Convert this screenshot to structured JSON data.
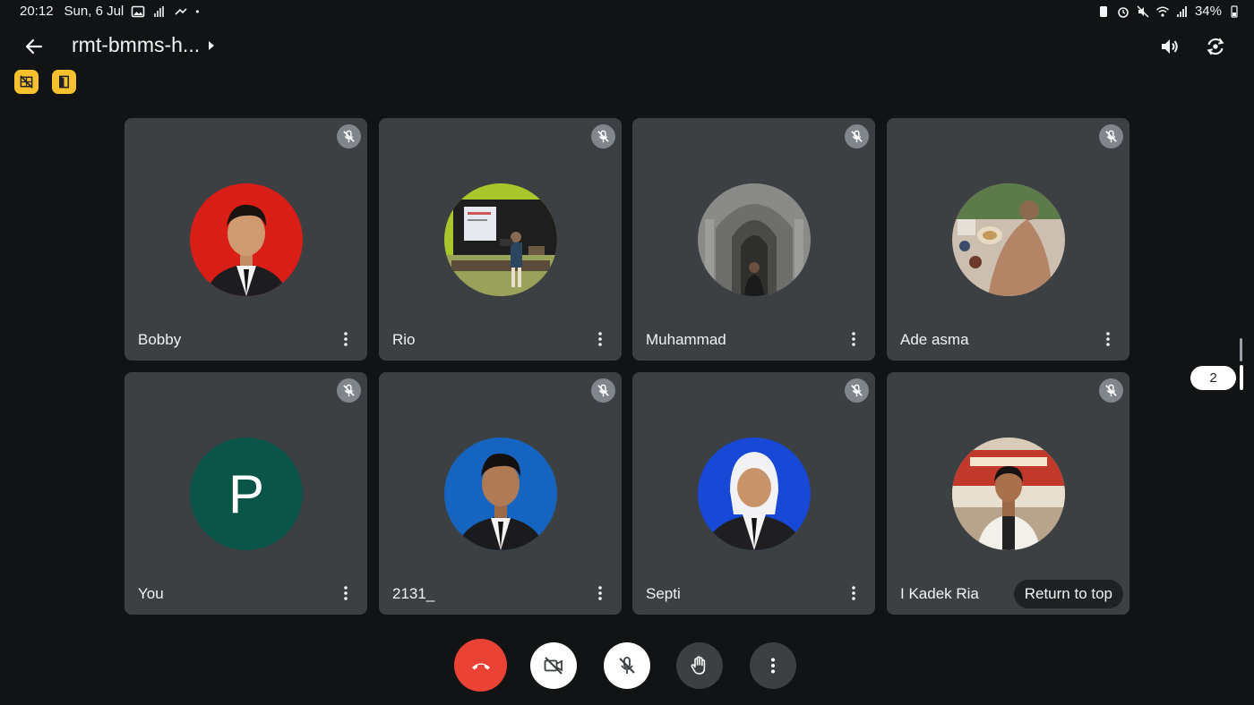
{
  "status_bar": {
    "time": "20:12",
    "date": "Sun, 6 Jul",
    "battery": "34%",
    "dot": "•"
  },
  "header": {
    "meeting_title": "rmt-bmms-h...",
    "icons": [
      "back-arrow-icon",
      "speaker-icon",
      "switch-camera-icon"
    ]
  },
  "indicators": [
    "no-camera-grid-icon",
    "door-exit-icon"
  ],
  "colors": {
    "background": "#121315",
    "tile": "#3c4043",
    "end_call": "#ea4335",
    "indicator": "#f5c12e"
  },
  "participants": [
    {
      "name": "Bobby",
      "avatar": "photo",
      "bg": "#d81e16",
      "muted": true
    },
    {
      "name": "Rio",
      "avatar": "photo",
      "bg": "#8fbf2e",
      "muted": true
    },
    {
      "name": "Muhammad",
      "avatar": "photo",
      "bg": "#7a7a78",
      "muted": true
    },
    {
      "name": "Ade asma",
      "avatar": "photo",
      "bg": "#b98c6e",
      "muted": true
    },
    {
      "name": "You",
      "avatar": "letter",
      "letter": "P",
      "bg": "#0b5548",
      "muted": true
    },
    {
      "name": "2131_",
      "avatar": "photo",
      "bg": "#1565c0",
      "muted": true
    },
    {
      "name": "Septi",
      "avatar": "photo",
      "bg": "#1748d6",
      "muted": true
    },
    {
      "name": "I Kadek Ria",
      "avatar": "photo",
      "bg": "#c9b9a8",
      "muted": true
    }
  ],
  "return_to_top_label": "Return to top",
  "page_indicator": "2",
  "controls": [
    "end-call-icon",
    "camera-off-icon",
    "mic-off-icon",
    "raise-hand-icon",
    "more-options-icon"
  ]
}
